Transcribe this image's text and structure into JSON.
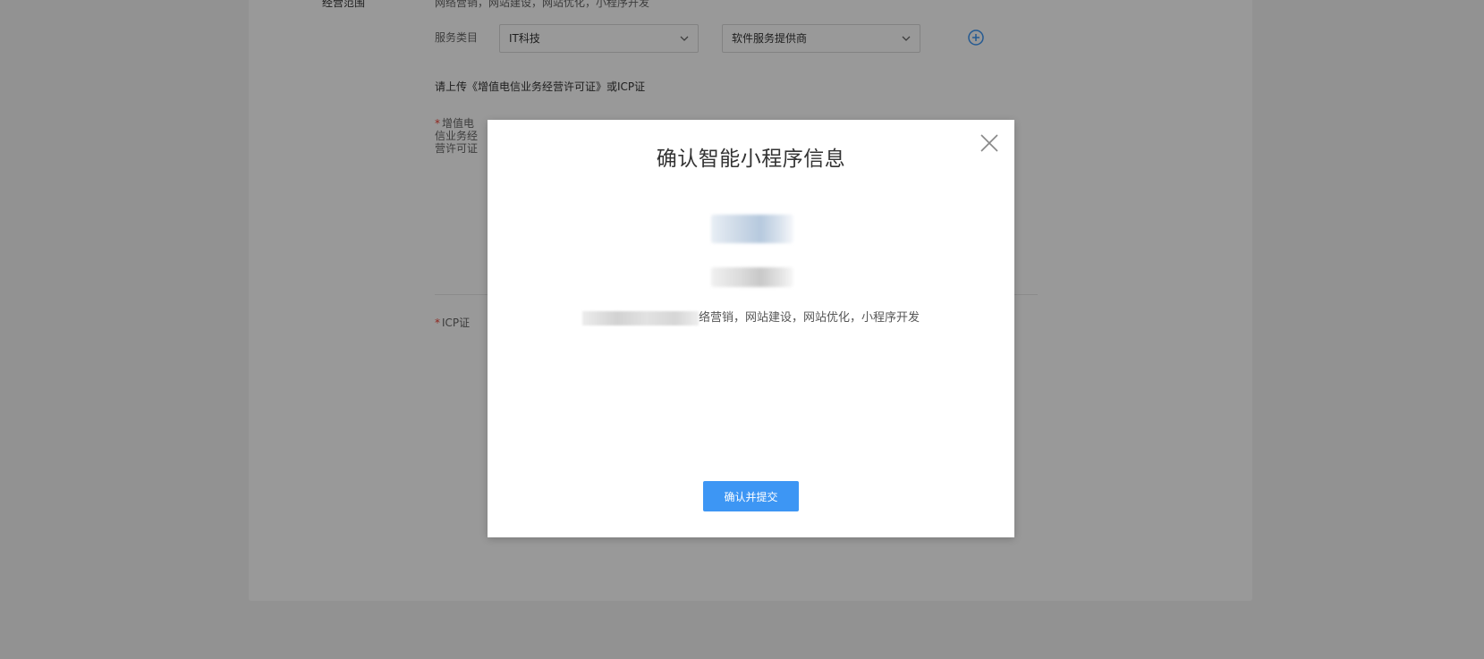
{
  "form": {
    "top_label_cut": "经营范围",
    "top_text_cut": "网络营销，网站建设，网站优化，小程序开发",
    "service_category_label": "服务类目",
    "category_primary": "IT科技",
    "category_secondary": "软件服务提供商",
    "upload_hint": "请上传《增值电信业务经营许可证》或ICP证",
    "license_label_line1": "增值电",
    "license_label_line2": "信业务经",
    "license_label_line3": "营许可证",
    "icp_label": "ICP证",
    "required_mark": "*"
  },
  "modal": {
    "title": "确认智能小程序信息",
    "description_visible": "络营销，网站建设，网站优化，小程序开发",
    "confirm_label": "确认并提交"
  },
  "colors": {
    "primary": "#3d96f4",
    "required": "#f04134",
    "overlay": "rgba(0,0,0,0.4)"
  },
  "icons": {
    "close": "close-icon",
    "add": "plus-circle-icon",
    "dropdown": "chevron-down-icon"
  }
}
